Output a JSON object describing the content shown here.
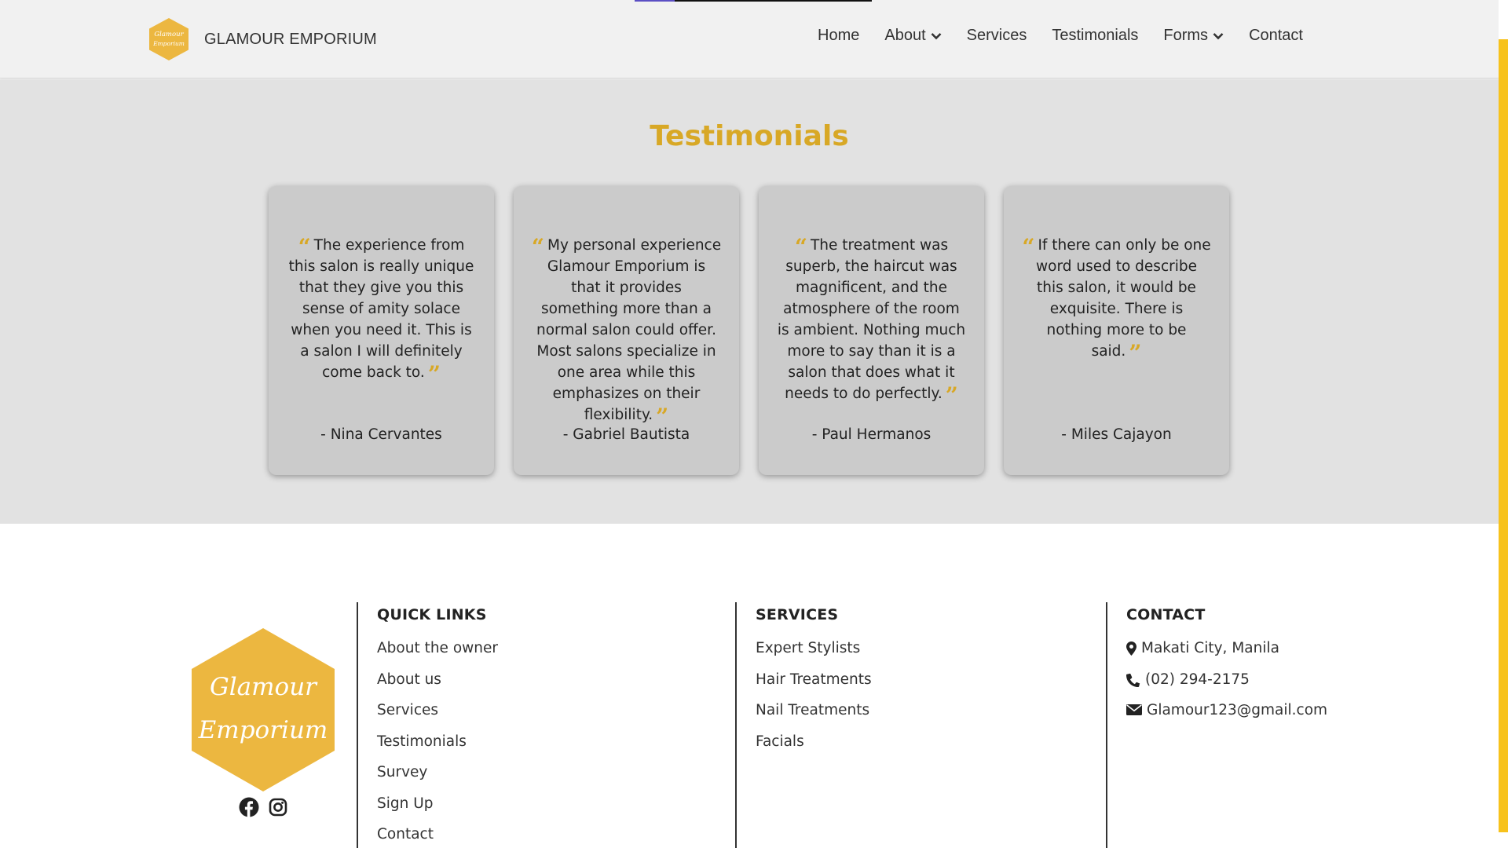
{
  "navbar": {
    "brand_name": "GLAMOUR EMPORIUM",
    "logo_text": [
      "Glamour",
      "Emporium"
    ],
    "reading_progress": 0.17,
    "links": [
      {
        "label": "Home",
        "dropdown": false
      },
      {
        "label": "About",
        "dropdown": true
      },
      {
        "label": "Services",
        "dropdown": false
      },
      {
        "label": "Testimonials",
        "dropdown": false
      },
      {
        "label": "Forms",
        "dropdown": true
      },
      {
        "label": "Contact",
        "dropdown": false
      }
    ]
  },
  "testimonials": {
    "title": "Testimonials",
    "items": [
      {
        "quote": "The experience from this salon is really unique that they give you this sense of amity solace when you need it. This is a salon I will definitely come back to.",
        "author": "- Nina Cervantes"
      },
      {
        "quote": "My personal experience Glamour Emporium is that it provides something more than a normal salon could offer. Most salons specialize in one area while this emphasizes on their flexibility.",
        "author": "- Gabriel Bautista"
      },
      {
        "quote": "The treatment was superb, the haircut was magnificent, and the atmosphere of the room is ambient. Nothing much more to say than it is a salon that does what it needs to do perfectly.",
        "author": "- Paul Hermanos"
      },
      {
        "quote": "If there can only be one word used to describe this salon, it would be exquisite. There is nothing more to be said.",
        "author": "- Miles Cajayon"
      }
    ]
  },
  "footer": {
    "logo_text": [
      "Glamour",
      "Emporium"
    ],
    "social": [
      "facebook-icon",
      "instagram-icon"
    ],
    "quick_links": {
      "heading": "QUICK LINKS",
      "items": [
        "About the owner",
        "About us",
        "Services",
        "Testimonials",
        "Survey",
        "Sign Up",
        "Contact"
      ]
    },
    "services": {
      "heading": "SERVICES",
      "items": [
        "Expert Stylists",
        "Hair Treatments",
        "Nail Treatments",
        "Facials"
      ]
    },
    "contact": {
      "heading": "CONTACT",
      "items": [
        {
          "icon": "map-marker-icon",
          "text": "Makati City, Manila"
        },
        {
          "icon": "phone-icon",
          "text": "(02) 294-2175"
        },
        {
          "icon": "envelope-icon",
          "text": "Glamour123@gmail.com"
        }
      ]
    }
  },
  "colors": {
    "accent_gold": "#d8a826",
    "logo_gold": "#ecb740",
    "scroll_thumb": "#f7c21c",
    "progress": "#5b4fc4"
  },
  "scrollbar": {
    "position": 0.72
  }
}
